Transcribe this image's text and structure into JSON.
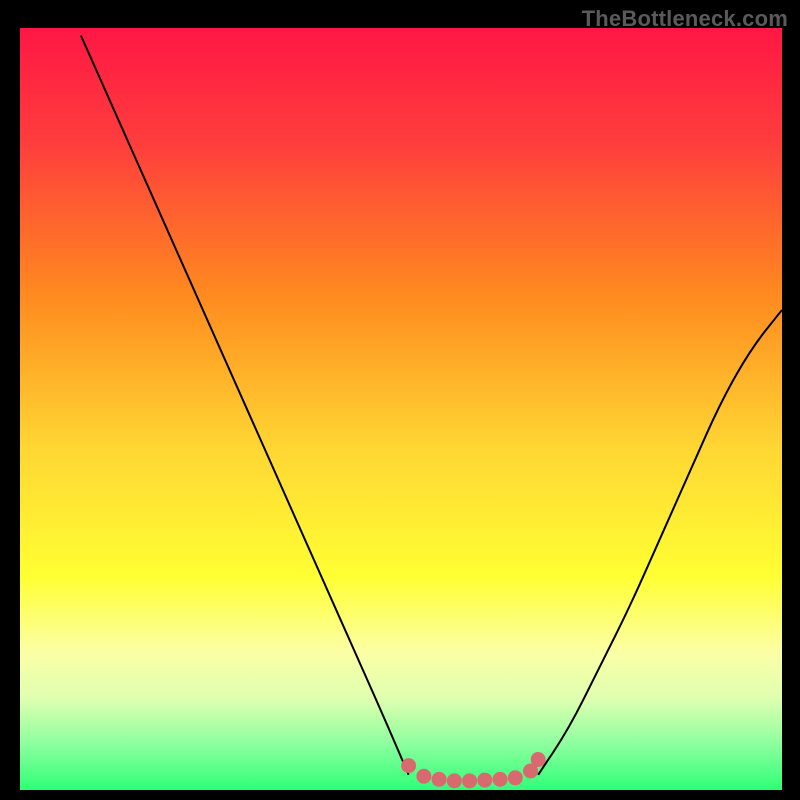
{
  "watermark": "TheBottleneck.com",
  "chart_data": {
    "type": "line",
    "title": "",
    "xlabel": "",
    "ylabel": "",
    "xlim": [
      0,
      100
    ],
    "ylim": [
      0,
      100
    ],
    "grid": false,
    "legend": false,
    "gradient_stops": [
      {
        "offset": 0.0,
        "color": "#ff1744"
      },
      {
        "offset": 0.15,
        "color": "#ff3d3d"
      },
      {
        "offset": 0.35,
        "color": "#ff8a1f"
      },
      {
        "offset": 0.55,
        "color": "#ffd633"
      },
      {
        "offset": 0.72,
        "color": "#ffff33"
      },
      {
        "offset": 0.82,
        "color": "#fbffa6"
      },
      {
        "offset": 0.88,
        "color": "#dfffb0"
      },
      {
        "offset": 0.94,
        "color": "#8cff9e"
      },
      {
        "offset": 1.0,
        "color": "#2eff77"
      }
    ],
    "series": [
      {
        "name": "left-curve",
        "x": [
          8,
          12,
          16,
          20,
          24,
          28,
          32,
          36,
          40,
          44,
          48,
          51
        ],
        "y": [
          99,
          90,
          81,
          72,
          63,
          54,
          45,
          36,
          27,
          18,
          9,
          2
        ]
      },
      {
        "name": "right-curve",
        "x": [
          68,
          72,
          76,
          80,
          84,
          88,
          92,
          96,
          100
        ],
        "y": [
          2,
          8,
          16,
          24,
          33,
          42,
          51,
          58,
          63
        ]
      },
      {
        "name": "bottleneck-marker",
        "marker_color": "#d86a6f",
        "x": [
          51,
          53,
          55,
          57,
          59,
          61,
          63,
          65,
          67,
          68
        ],
        "y": [
          3.2,
          1.8,
          1.4,
          1.2,
          1.2,
          1.3,
          1.4,
          1.6,
          2.5,
          4.0
        ]
      }
    ],
    "marker_end_point": {
      "x": 68,
      "y": 4.0
    }
  }
}
